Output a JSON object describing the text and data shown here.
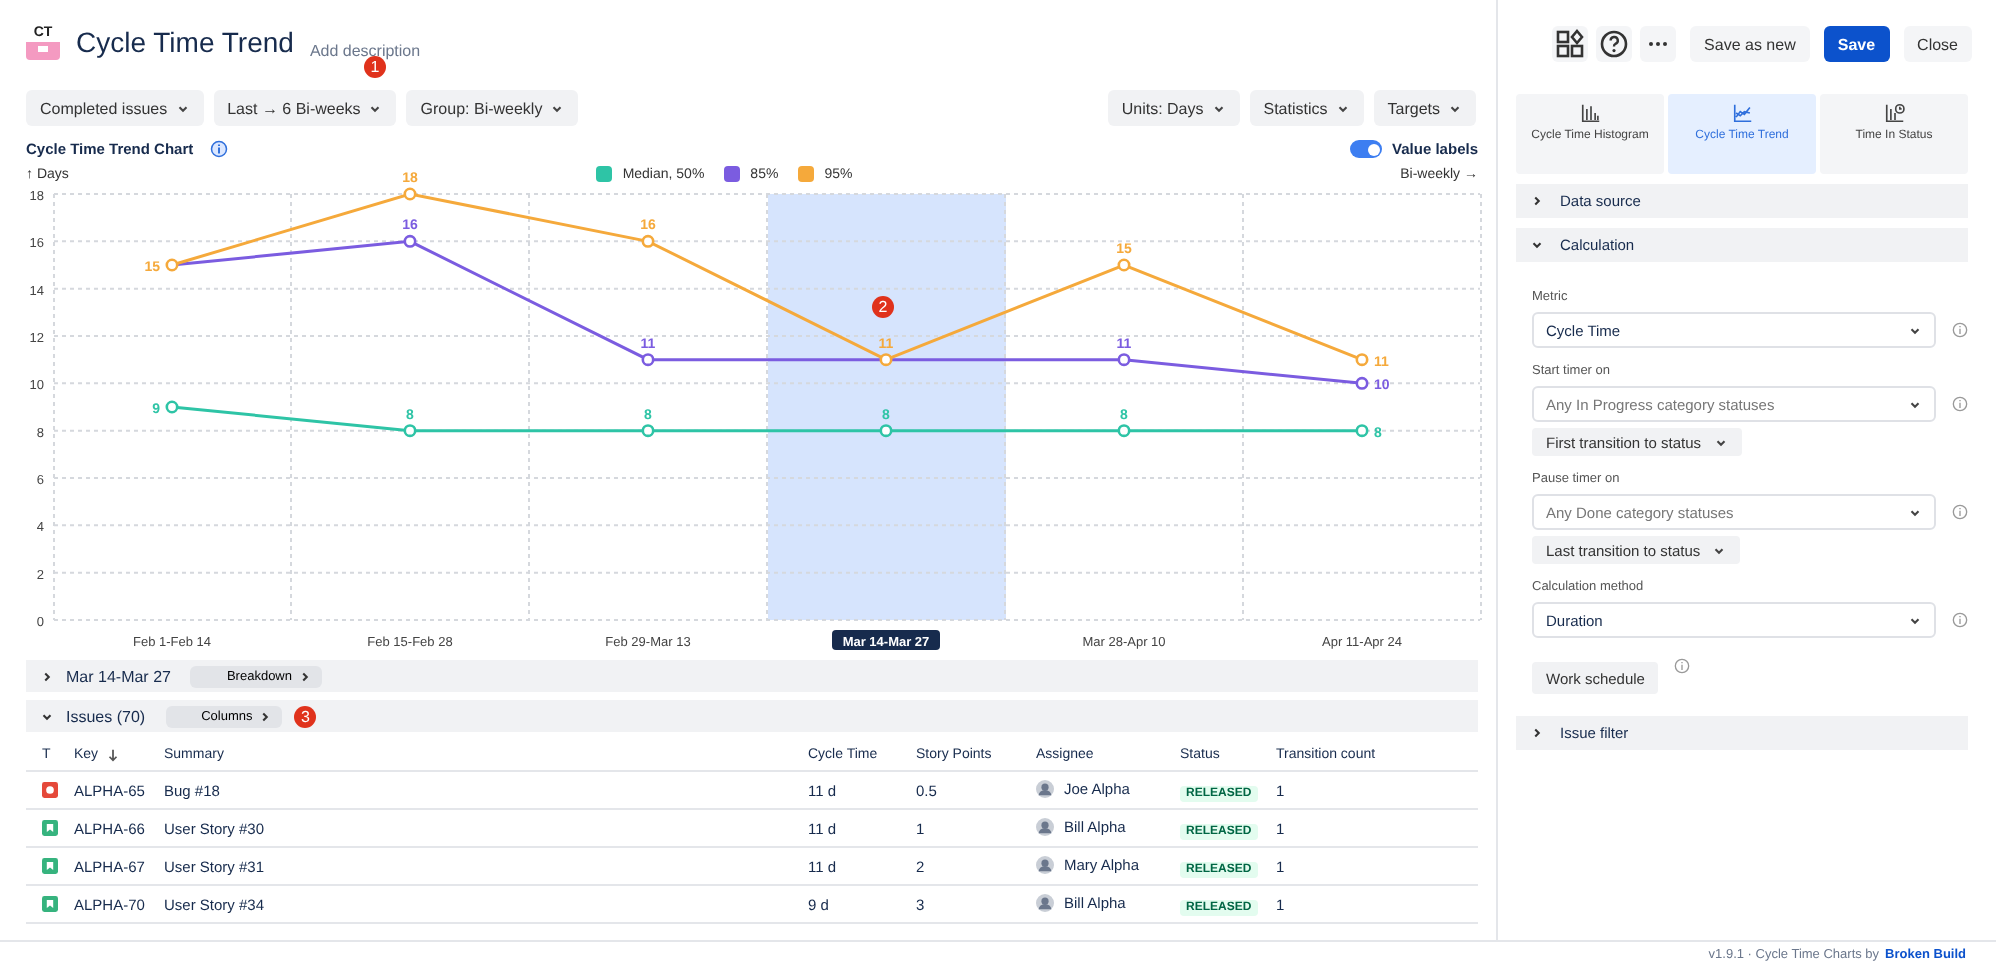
{
  "header": {
    "logo": "CT",
    "title": "Cycle Time Trend",
    "description_link": "Add description",
    "callout": "1",
    "actions": [
      {
        "label": "Save as new",
        "kind": "default"
      },
      {
        "label": "Save",
        "kind": "primary"
      },
      {
        "label": "Close",
        "kind": "subtle"
      }
    ]
  },
  "filters_left": [
    "Completed issues",
    "Last → 6 Bi-weeks",
    "Group: Bi-weekly"
  ],
  "filters_right": [
    "Units: Days",
    "Statistics",
    "Targets"
  ],
  "chart": {
    "title": "Cycle Time Trend Chart",
    "value_labels": {
      "label": "Value labels",
      "on": true
    },
    "callout": "2",
    "periods": [
      {
        "selected": false
      },
      {
        "selected": false
      },
      {
        "selected": false
      },
      {
        "selected": true
      },
      {
        "selected": false
      },
      {
        "selected": false
      }
    ],
    "chart_data": {
      "type": "line",
      "ylabel": "↑ Days",
      "xlabel": "Bi-weekly →",
      "categories": [
        "Feb 1-Feb 14",
        "Feb 15-Feb 28",
        "Feb 29-Mar 13",
        "Mar 14-Mar 27",
        "Mar 28-Apr 10",
        "Apr 11-Apr 24"
      ],
      "series": [
        {
          "name": "Median, 50%",
          "color": "#2ec4a6",
          "marker": "circle",
          "values": [
            9,
            8,
            8,
            8,
            8,
            8
          ],
          "value_labels": [
            "9",
            "8",
            "8",
            "8",
            "8",
            "8"
          ]
        },
        {
          "name": "85%",
          "color": "#7b5ce0",
          "marker": "circle",
          "values": [
            15,
            16,
            11,
            11,
            11,
            10
          ],
          "value_labels": [
            null,
            "16",
            "11",
            null,
            "11",
            "10"
          ]
        },
        {
          "name": "95%",
          "color": "#f5a93b",
          "marker": "circle",
          "values": [
            15,
            18,
            16,
            11,
            15,
            11
          ],
          "value_labels": [
            "15",
            "18",
            "16",
            "11",
            "15",
            "11"
          ]
        }
      ],
      "grid": true,
      "ylim": [
        0,
        18
      ],
      "yticks": [
        0,
        2,
        4,
        6,
        8,
        10,
        12,
        14,
        16,
        18
      ]
    }
  },
  "breakdown": {
    "label": "Mar 14-Mar 27",
    "expanded": false,
    "button": "Breakdown"
  },
  "issues": {
    "label": "Issues (70)",
    "expanded": true,
    "button": "Columns",
    "callout": "3",
    "columns": [
      "T",
      "Key",
      "Summary",
      "Cycle Time",
      "Story Points",
      "Assignee",
      "Status",
      "Transition count"
    ],
    "rows": [
      {
        "kind": "bug",
        "key": "ALPHA-65",
        "summary": "Bug #18",
        "cycle_time": "11 d",
        "story_points": "0.5",
        "assignee": "Joe Alpha",
        "status": "RELEASED",
        "transition_count": "1"
      },
      {
        "kind": "story",
        "key": "ALPHA-66",
        "summary": "User Story #30",
        "cycle_time": "11 d",
        "story_points": "1",
        "assignee": "Bill Alpha",
        "status": "RELEASED",
        "transition_count": "1"
      },
      {
        "kind": "story",
        "key": "ALPHA-67",
        "summary": "User Story #31",
        "cycle_time": "11 d",
        "story_points": "2",
        "assignee": "Mary Alpha",
        "status": "RELEASED",
        "transition_count": "1"
      },
      {
        "kind": "story",
        "key": "ALPHA-70",
        "summary": "User Story #34",
        "cycle_time": "9 d",
        "story_points": "3",
        "assignee": "Bill Alpha",
        "status": "RELEASED",
        "transition_count": "1"
      }
    ]
  },
  "chart_types": [
    {
      "kind": "histogram",
      "label": "Cycle Time Histogram",
      "selected": false
    },
    {
      "kind": "trend",
      "label": "Cycle Time Trend",
      "selected": true
    },
    {
      "kind": "status",
      "label": "Time In Status",
      "selected": false
    }
  ],
  "sections": [
    {
      "label": "Data source",
      "expanded": false
    },
    {
      "label": "Calculation",
      "expanded": true,
      "fields": [
        {
          "kind": "label",
          "text": "Metric"
        },
        {
          "kind": "select",
          "text": "Cycle Time",
          "filled": true
        },
        {
          "kind": "label",
          "text": "Start timer on"
        },
        {
          "kind": "select",
          "text": "Any In Progress category statuses",
          "filled": false
        },
        {
          "kind": "menu",
          "text": "First transition to status"
        },
        {
          "kind": "label",
          "text": "Pause timer on"
        },
        {
          "kind": "select",
          "text": "Any Done category statuses",
          "filled": false
        },
        {
          "kind": "menu",
          "text": "Last transition to status"
        },
        {
          "kind": "label",
          "text": "Calculation method"
        },
        {
          "kind": "select",
          "text": "Duration",
          "filled": true
        },
        {
          "kind": "button",
          "text": "Work schedule"
        }
      ]
    },
    {
      "label": "Issue filter",
      "expanded": false
    }
  ],
  "footer": {
    "text": "v1.9.1 · Cycle Time Charts by",
    "link": "Broken Build"
  }
}
